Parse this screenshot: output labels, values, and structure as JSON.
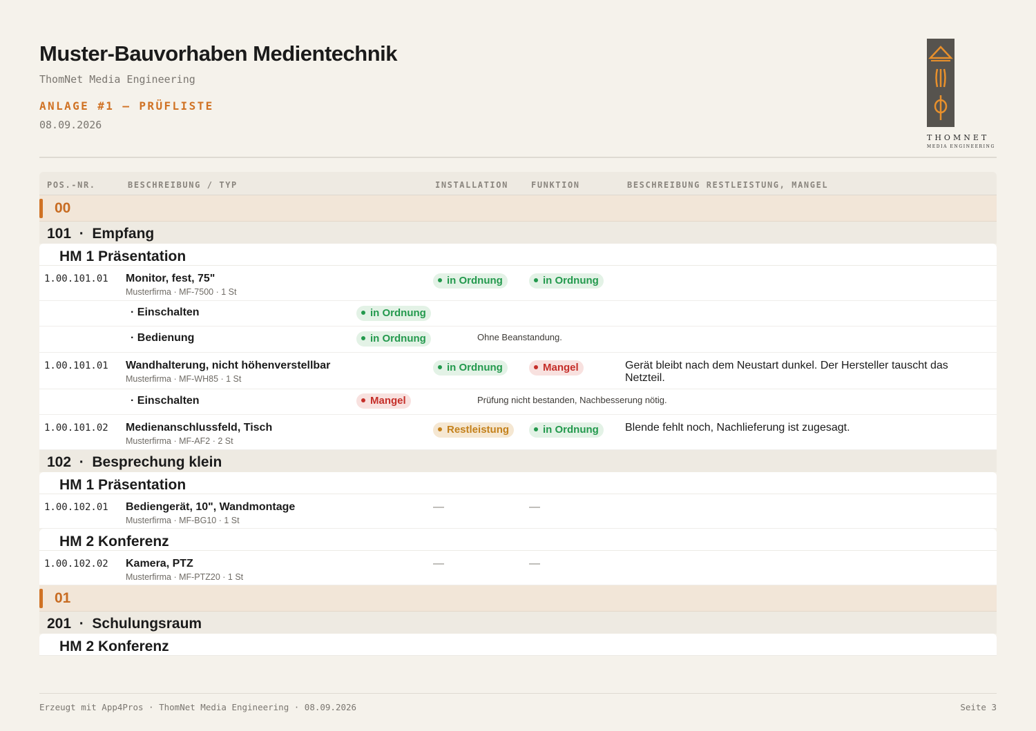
{
  "header": {
    "title": "Muster-Bauvorhaben Medientechnik",
    "company": "ThomNet Media Engineering",
    "annex": "ANLAGE #1 — PRÜFLISTE",
    "date": "08.09.2026",
    "logo_word": "THOMNET",
    "logo_sub": "MEDIA ENGINEERING"
  },
  "table": {
    "columns": {
      "pos": "POS.-NR.",
      "desc": "BESCHREIBUNG / TYP",
      "install": "INSTALLATION",
      "function": "FUNKTION",
      "remark": "BESCHREIBUNG RESTLEISTUNG, MANGEL"
    },
    "floors": [
      {
        "label": "00",
        "rooms": [
          {
            "number": "101",
            "sep": "·",
            "name": "Empfang",
            "groups": [
              {
                "label": "HM 1 Präsentation",
                "items": [
                  {
                    "pos": "1.00.101.01",
                    "name": "Monitor, fest, 75\"",
                    "meta": "Musterfirma · MF-7500 · 1 St",
                    "install": "in Ordnung",
                    "function": "in Ordnung",
                    "remark": "",
                    "subs": [
                      {
                        "name": "· Einschalten",
                        "status": "in Ordnung",
                        "note": ""
                      },
                      {
                        "name": "· Bedienung",
                        "status": "in Ordnung",
                        "note": "Ohne Beanstandung."
                      }
                    ]
                  },
                  {
                    "pos": "1.00.101.01",
                    "name": "Wandhalterung, nicht höhenverstellbar",
                    "meta": "Musterfirma · MF-WH85 · 1 St",
                    "install": "in Ordnung",
                    "function": "Mangel",
                    "remark": "Gerät bleibt nach dem Neustart dunkel. Der Hersteller tauscht das Netzteil.",
                    "subs": [
                      {
                        "name": "· Einschalten",
                        "status": "Mangel",
                        "note": "Prüfung nicht bestanden, Nachbesserung nötig."
                      }
                    ]
                  },
                  {
                    "pos": "1.00.101.02",
                    "name": "Medienanschlussfeld, Tisch",
                    "meta": "Musterfirma · MF-AF2 · 2 St",
                    "install": "Restleistung",
                    "function": "in Ordnung",
                    "remark": "Blende fehlt noch, Nachlieferung ist zugesagt.",
                    "subs": []
                  }
                ]
              }
            ]
          },
          {
            "number": "102",
            "sep": "·",
            "name": "Besprechung klein",
            "groups": [
              {
                "label": "HM 1 Präsentation",
                "items": [
                  {
                    "pos": "1.00.102.01",
                    "name": "Bediengerät, 10\", Wandmontage",
                    "meta": "Musterfirma · MF-BG10 · 1 St",
                    "install": "—",
                    "function": "—",
                    "remark": "",
                    "subs": []
                  }
                ]
              },
              {
                "label": "HM 2 Konferenz",
                "items": [
                  {
                    "pos": "1.00.102.02",
                    "name": "Kamera, PTZ",
                    "meta": "Musterfirma · MF-PTZ20 · 1 St",
                    "install": "—",
                    "function": "—",
                    "remark": "",
                    "subs": []
                  }
                ]
              }
            ]
          }
        ]
      },
      {
        "label": "01",
        "rooms": [
          {
            "number": "201",
            "sep": "·",
            "name": "Schulungsraum",
            "groups": [
              {
                "label": "HM 2 Konferenz",
                "items": []
              }
            ]
          }
        ]
      }
    ]
  },
  "footer": {
    "left": "Erzeugt mit App4Pros · ThomNet Media Engineering · 08.09.2026",
    "right": "Seite 3"
  },
  "colors": {
    "accent": "#d07224",
    "ok": "#23994d",
    "defect": "#c52f2a",
    "pending": "#c4811b"
  }
}
